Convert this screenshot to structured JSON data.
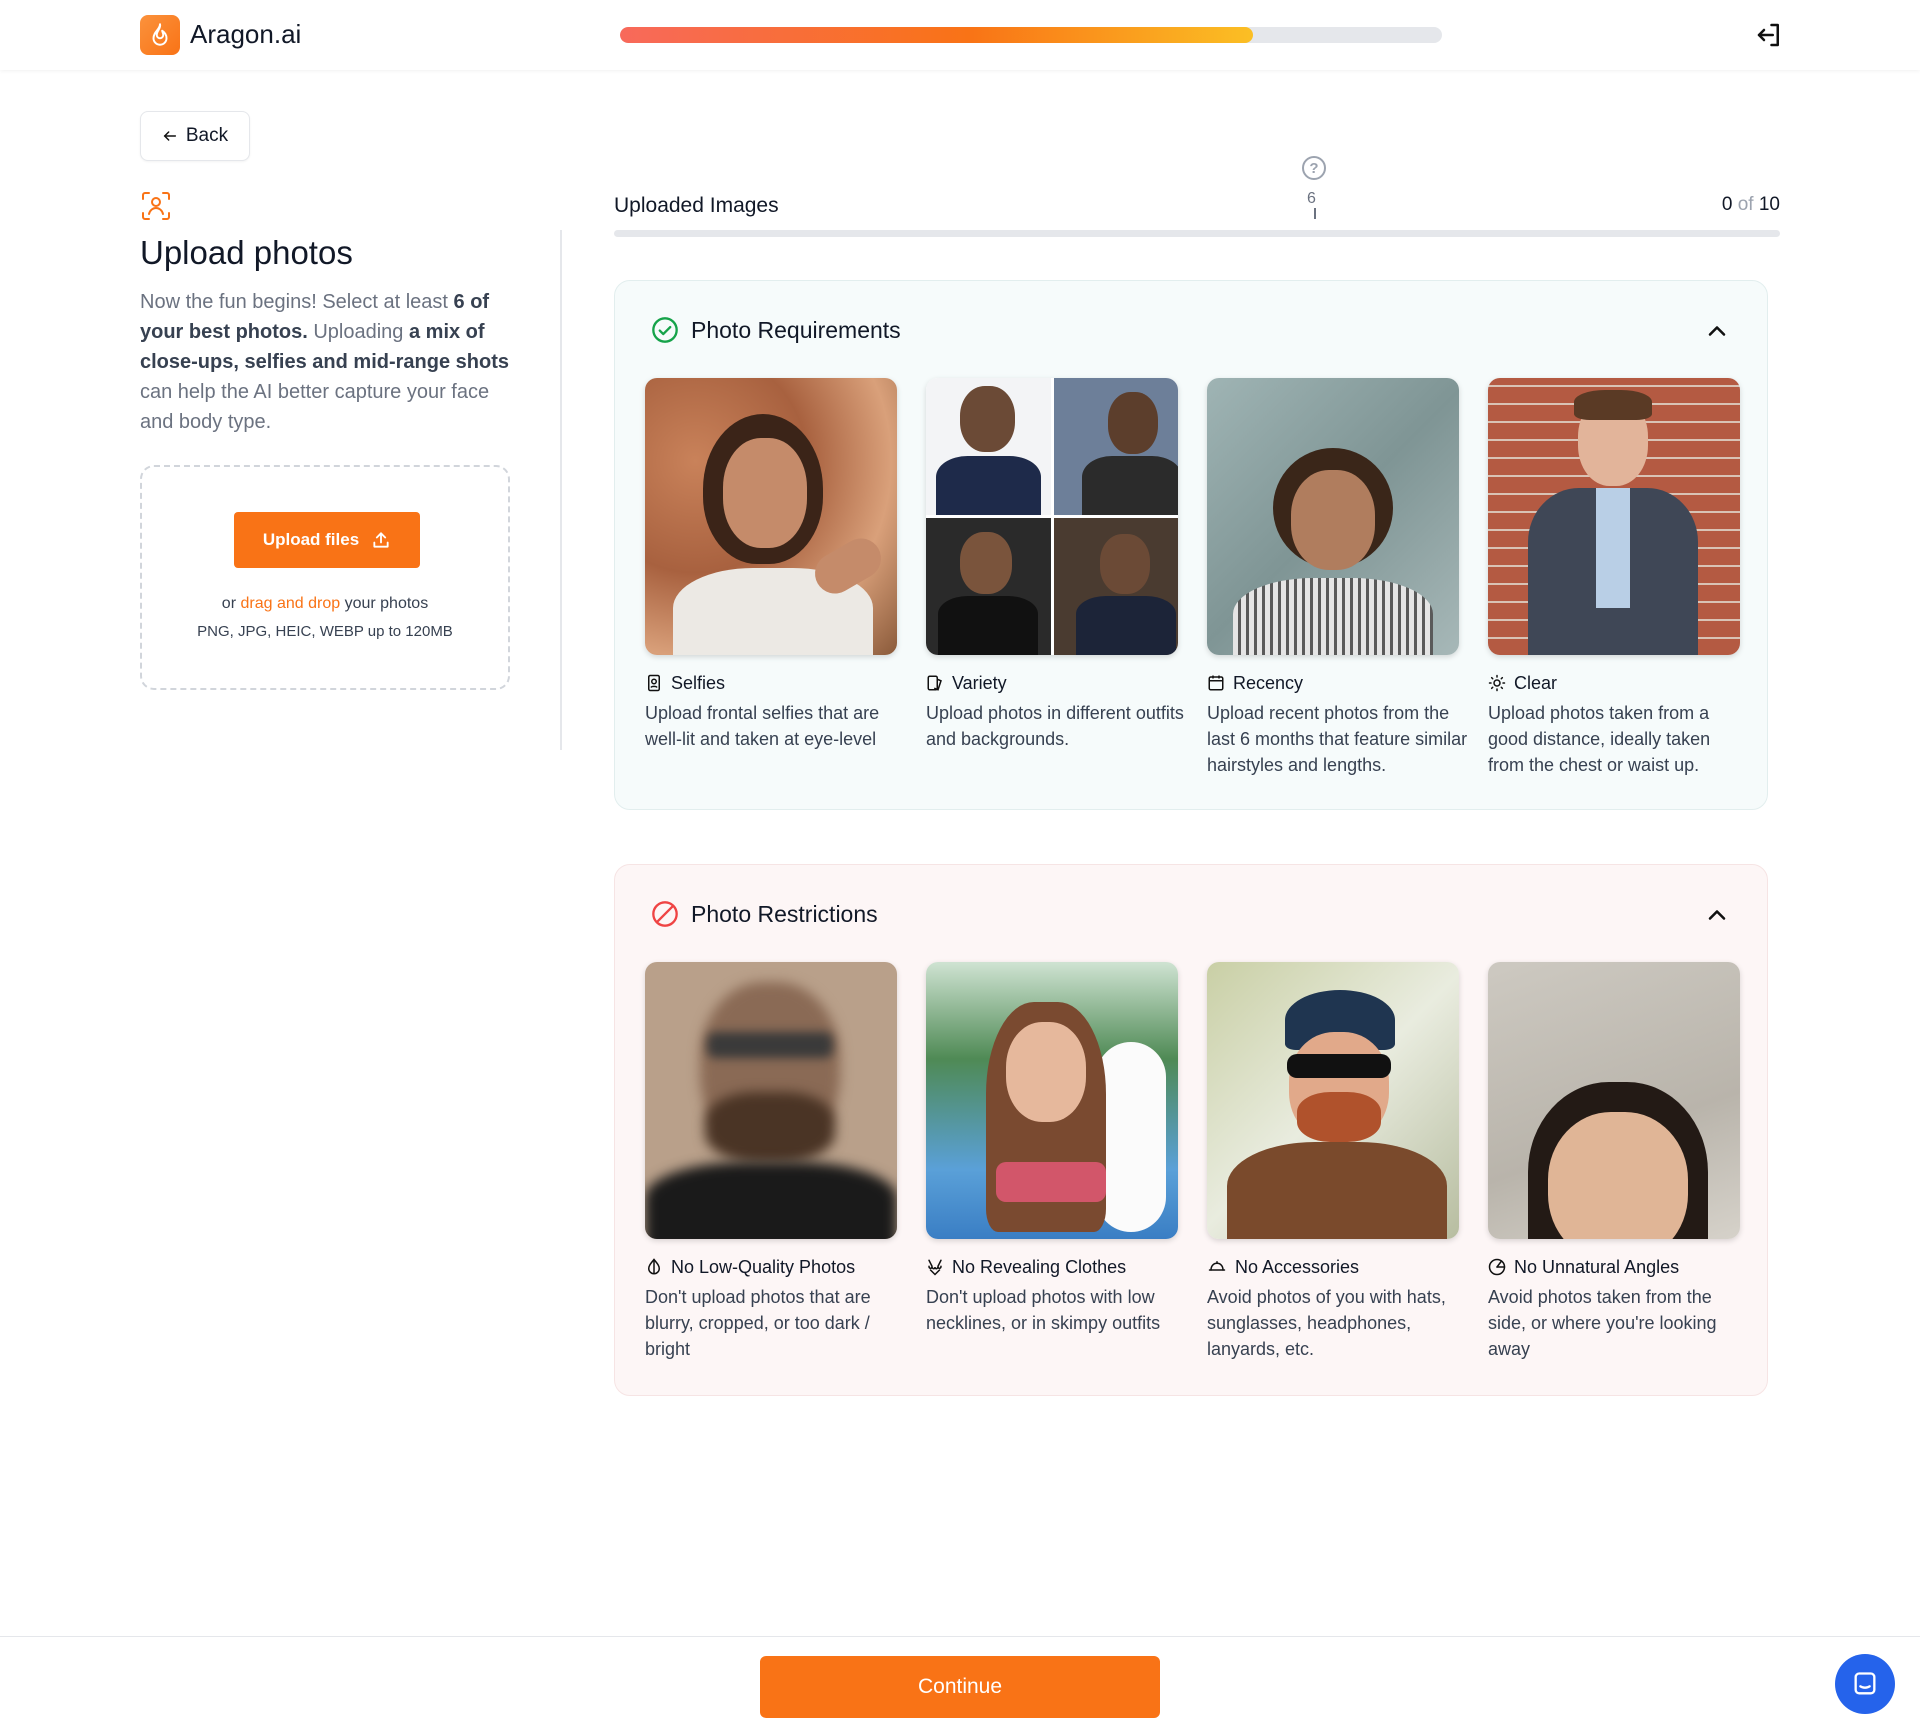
{
  "header": {
    "app_name": "Aragon.ai",
    "progress_fraction": 0.77,
    "icons": {
      "logo": "flame-icon",
      "logout": "logout-icon"
    }
  },
  "left": {
    "back_label": "Back",
    "title": "Upload photos",
    "description_parts": [
      "Now the fun begins! Select at least ",
      "6 of your best photos.",
      " Uploading ",
      "a mix of close-ups, selfies and mid-range shots",
      " can help the AI better capture your face and body type."
    ],
    "upload_button": "Upload files",
    "drop_or": "or",
    "drop_link": "drag and drop",
    "drop_suffix": "your photos",
    "formats": "PNG, JPG, HEIC, WEBP up to 120MB"
  },
  "uploaded": {
    "label": "Uploaded Images",
    "marker": "6",
    "current": "0",
    "of": "of",
    "total": "10"
  },
  "requirements": {
    "title": "Photo Requirements",
    "accent": "#16a34a",
    "cards": [
      {
        "title": "Selfies",
        "icon": "selfie-phone-icon",
        "desc": "Upload frontal selfies that are well-lit and taken at eye-level"
      },
      {
        "title": "Variety",
        "icon": "images-icon",
        "desc": "Upload photos in different outfits and backgrounds."
      },
      {
        "title": "Recency",
        "icon": "calendar-icon",
        "desc": "Upload recent photos from the last 6 months that feature similar hairstyles and lengths."
      },
      {
        "title": "Clear",
        "icon": "sun-icon",
        "desc": "Upload photos taken from a good distance, ideally taken from the chest or waist up."
      }
    ]
  },
  "restrictions": {
    "title": "Photo Restrictions",
    "accent": "#ef4444",
    "cards": [
      {
        "title": "No Low-Quality Photos",
        "icon": "contrast-drop-icon",
        "desc": "Don't upload photos that are blurry, cropped, or too dark / bright"
      },
      {
        "title": "No Revealing Clothes",
        "icon": "bikini-icon",
        "desc": "Don't upload photos with low necklines, or in skimpy outfits"
      },
      {
        "title": "No Accessories",
        "icon": "cap-icon",
        "desc": "Avoid photos of you with hats, sunglasses, headphones, lanyards, etc."
      },
      {
        "title": "No Unnatural Angles",
        "icon": "angle-icon",
        "desc": "Avoid photos taken from the side, or where you're looking away"
      }
    ]
  },
  "footer": {
    "continue_label": "Continue",
    "chat_icon": "chat-icon"
  }
}
